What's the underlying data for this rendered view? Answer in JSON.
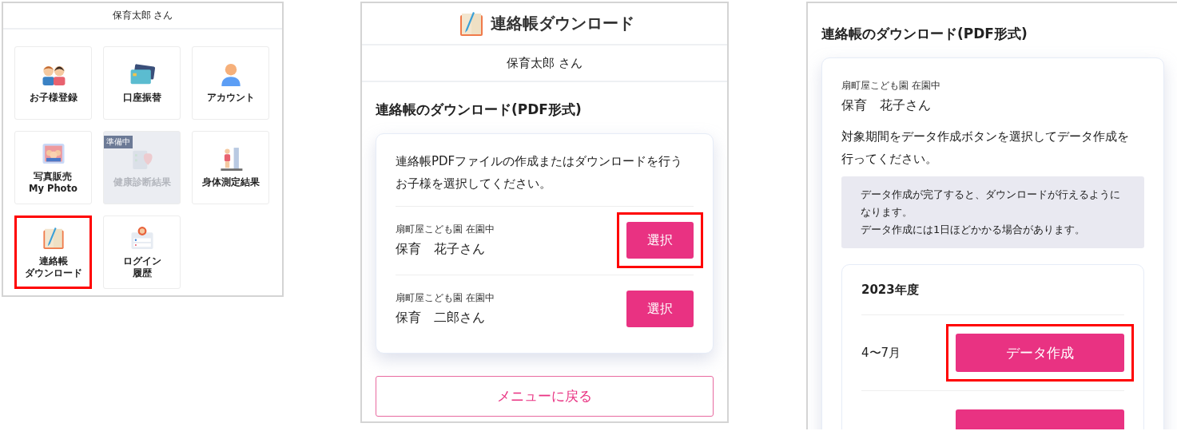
{
  "menu_screen": {
    "user": "保育太郎 さん",
    "tiles": [
      {
        "lines": [
          "お子様登録"
        ],
        "disabled": false,
        "highlighted": false
      },
      {
        "lines": [
          "口座振替"
        ],
        "disabled": false,
        "highlighted": false
      },
      {
        "lines": [
          "アカウント"
        ],
        "disabled": false,
        "highlighted": false
      },
      {
        "lines": [
          "写真販売",
          "My Photo"
        ],
        "disabled": false,
        "highlighted": false
      },
      {
        "lines": [
          "健康診断結果"
        ],
        "disabled": true,
        "badge": "準備中",
        "highlighted": false
      },
      {
        "lines": [
          "身体測定結果"
        ],
        "disabled": false,
        "highlighted": false
      },
      {
        "lines": [
          "連絡帳",
          "ダウンロード"
        ],
        "disabled": false,
        "highlighted": true
      },
      {
        "lines": [
          "ログイン",
          "履歴"
        ],
        "disabled": false,
        "highlighted": false
      }
    ]
  },
  "child_select_screen": {
    "title": "連絡帳ダウンロード",
    "user": "保育太郎 さん",
    "heading": "連絡帳のダウンロード(PDF形式)",
    "instruction": "連絡帳PDFファイルの作成またはダウンロードを行うお子様を選択してください。",
    "child_rows": [
      {
        "school": "扇町屋こども園 在園中",
        "name": "保育　花子さん",
        "button": "選択",
        "highlighted": true
      },
      {
        "school": "扇町屋こども園 在園中",
        "name": "保育　二郎さん",
        "button": "選択",
        "highlighted": false
      }
    ],
    "back_button": "メニューに戻る"
  },
  "data_create_screen": {
    "heading": "連絡帳のダウンロード(PDF形式)",
    "school": "扇町屋こども園 在園中",
    "name": "保育　花子さん",
    "instruction": "対象期間をデータ作成ボタンを選択してデータ作成を行ってください。",
    "notes": [
      "データ作成が完了すると、ダウンロードが行えるようになります。",
      "データ作成には1日ほどかかる場合があります。"
    ],
    "year": "2023年度",
    "periods": [
      {
        "kind": "full",
        "label": "4〜7月",
        "button": "データ作成",
        "highlighted": true
      },
      {
        "kind": "cut",
        "highlighted": false
      }
    ]
  }
}
